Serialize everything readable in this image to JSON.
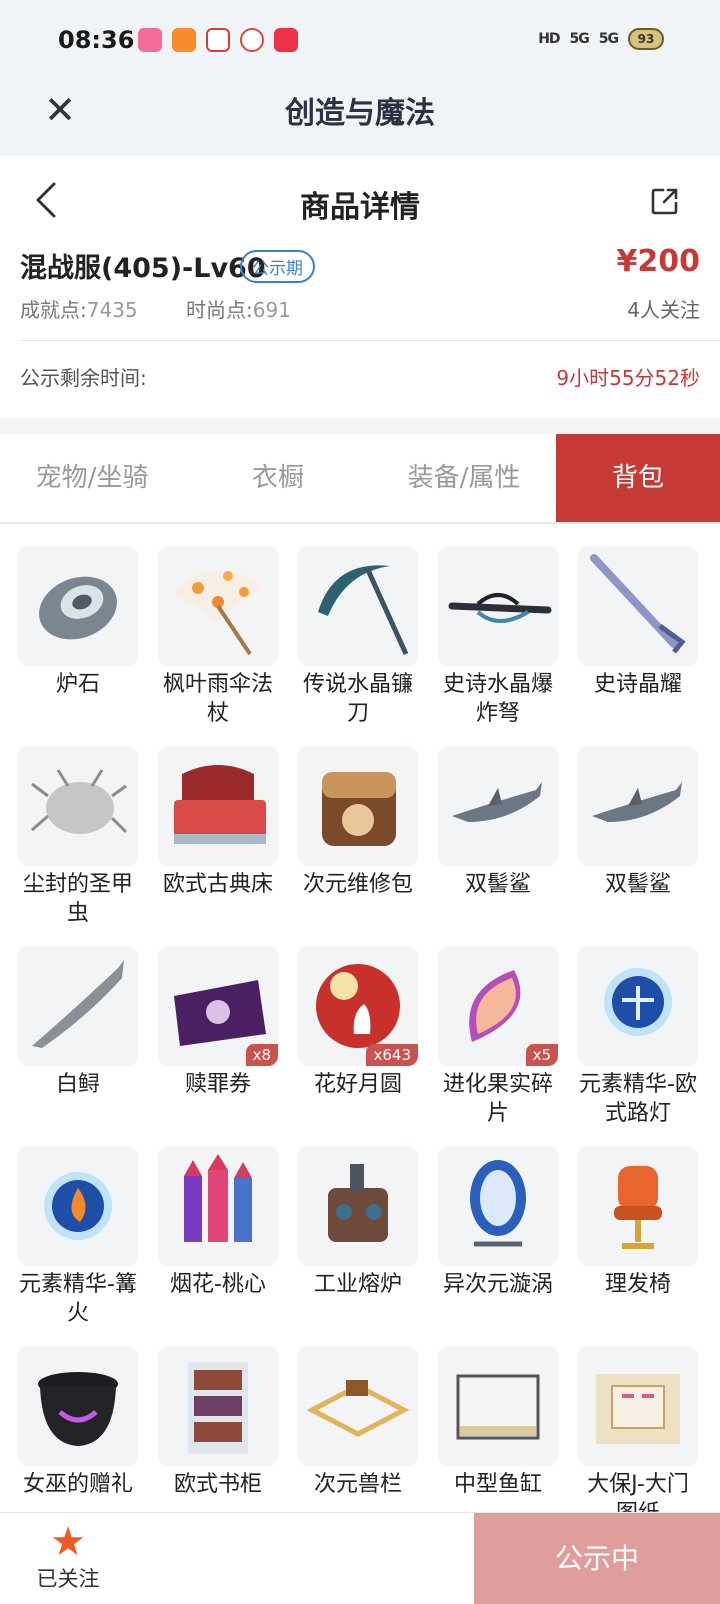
{
  "status_bar": {
    "time": "08:36",
    "signal_1": "5G",
    "signal_2": "5G",
    "battery": "93"
  },
  "header": {
    "title": "创造与魔法",
    "close_icon": "close-icon"
  },
  "nav": {
    "title": "商品详情",
    "back_icon": "chevron-left-icon",
    "share_icon": "share-icon"
  },
  "product": {
    "name": "混战服(405)-Lv60",
    "badge": "公示期",
    "price": "¥200",
    "achievement_label": "成就点:",
    "achievement_value": "7435",
    "fashion_label": "时尚点:",
    "fashion_value": "691",
    "followers": "4人关注"
  },
  "countdown": {
    "label": "公示剩余时间:",
    "value": "9小时55分52秒"
  },
  "tabs": [
    {
      "label": "宠物/坐骑",
      "active": false
    },
    {
      "label": "衣橱",
      "active": false
    },
    {
      "label": "装备/属性",
      "active": false
    },
    {
      "label": "背包",
      "active": true
    }
  ],
  "items": [
    {
      "name": "炉石",
      "count": "",
      "icon": "hearthstone-icon"
    },
    {
      "name": "枫叶雨伞法杖",
      "count": "",
      "icon": "umbrella-icon"
    },
    {
      "name": "传说水晶镰刀",
      "count": "",
      "icon": "scythe-icon"
    },
    {
      "name": "史诗水晶爆炸弩",
      "count": "",
      "icon": "crossbow-icon"
    },
    {
      "name": "史诗晶耀",
      "count": "",
      "icon": "sword-icon"
    },
    {
      "name": "尘封的圣甲虫",
      "count": "",
      "icon": "scarab-icon"
    },
    {
      "name": "欧式古典床",
      "count": "",
      "icon": "bed-icon"
    },
    {
      "name": "次元维修包",
      "count": "",
      "icon": "bag-icon"
    },
    {
      "name": "双髻鲨",
      "count": "",
      "icon": "shark-icon"
    },
    {
      "name": "双髻鲨",
      "count": "",
      "icon": "shark-icon"
    },
    {
      "name": "白鲟",
      "count": "",
      "icon": "fish-icon"
    },
    {
      "name": "赎罪券",
      "count": "x8",
      "icon": "scroll-icon"
    },
    {
      "name": "花好月圆",
      "count": "x643",
      "icon": "moon-icon"
    },
    {
      "name": "进化果实碎片",
      "count": "x5",
      "icon": "fruit-slice-icon"
    },
    {
      "name": "元素精华-欧式路灯",
      "count": "",
      "icon": "orb-icon"
    },
    {
      "name": "元素精华-篝火",
      "count": "",
      "icon": "campfire-orb-icon"
    },
    {
      "name": "烟花-桃心",
      "count": "",
      "icon": "firework-icon"
    },
    {
      "name": "工业熔炉",
      "count": "",
      "icon": "furnace-icon"
    },
    {
      "name": "异次元漩涡",
      "count": "",
      "icon": "portal-icon"
    },
    {
      "name": "理发椅",
      "count": "",
      "icon": "chair-icon"
    },
    {
      "name": "女巫的赠礼",
      "count": "",
      "icon": "cauldron-icon"
    },
    {
      "name": "欧式书柜",
      "count": "",
      "icon": "bookcase-icon"
    },
    {
      "name": "次元兽栏",
      "count": "",
      "icon": "fence-icon"
    },
    {
      "name": "中型鱼缸",
      "count": "",
      "icon": "aquarium-icon"
    },
    {
      "name": "大保J-大门图纸",
      "count": "",
      "icon": "blueprint-icon"
    }
  ],
  "bottom": {
    "follow_label": "已关注",
    "status_button": "公示中"
  },
  "colors": {
    "accent_red": "#c63a35",
    "badge_blue": "#3b82c4",
    "disabled_button": "#df9d9b",
    "star_orange": "#f05a22"
  }
}
